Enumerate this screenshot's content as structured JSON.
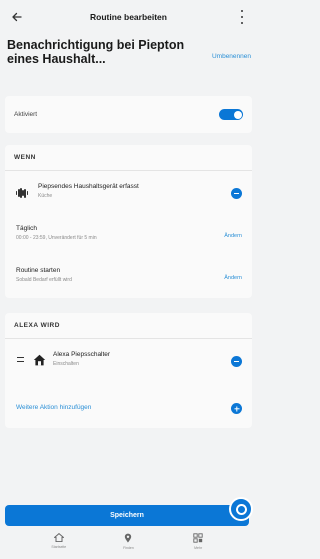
{
  "header": {
    "back_icon": "arrow-left-icon",
    "title": "Routine bearbeiten",
    "more_icon": "more-vertical-icon"
  },
  "routine": {
    "name": "Benachrichtigung bei Piepton eines Haushalt...",
    "rename_label": "Umbenennen"
  },
  "enabled": {
    "label": "Aktiviert",
    "on": true
  },
  "when": {
    "heading": "WENN",
    "trigger": {
      "icon": "sound-wave-icon",
      "title": "Piepsendes Haushaltsgerät erfasst",
      "subtitle": "Küche"
    },
    "schedule": {
      "title": "Täglich",
      "subtitle": "00:00 - 23:59, Unverändert für 5 min",
      "action": "Ändern"
    },
    "start": {
      "title": "Routine starten",
      "subtitle": "Sobald Bedarf erfüllt wird",
      "action": "Ändern"
    }
  },
  "alexa": {
    "heading": "ALEXA WIRD",
    "action": {
      "icon": "smart-home-icon",
      "title": "Alexa Piepsschalter",
      "subtitle": "Einschalten"
    },
    "add_label": "Weitere Aktion hinzufügen"
  },
  "save_label": "Speichern",
  "fab_icon": "alexa-icon",
  "nav": [
    {
      "icon": "home-icon",
      "label": "Startseite"
    },
    {
      "icon": "map-pin-icon",
      "label": "Finden"
    },
    {
      "icon": "devices-icon",
      "label": "Mehr"
    }
  ],
  "colors": {
    "accent": "#0b77d6",
    "link": "#2a8fd6",
    "background": "#f2f3f4",
    "card": "#fafafa"
  }
}
